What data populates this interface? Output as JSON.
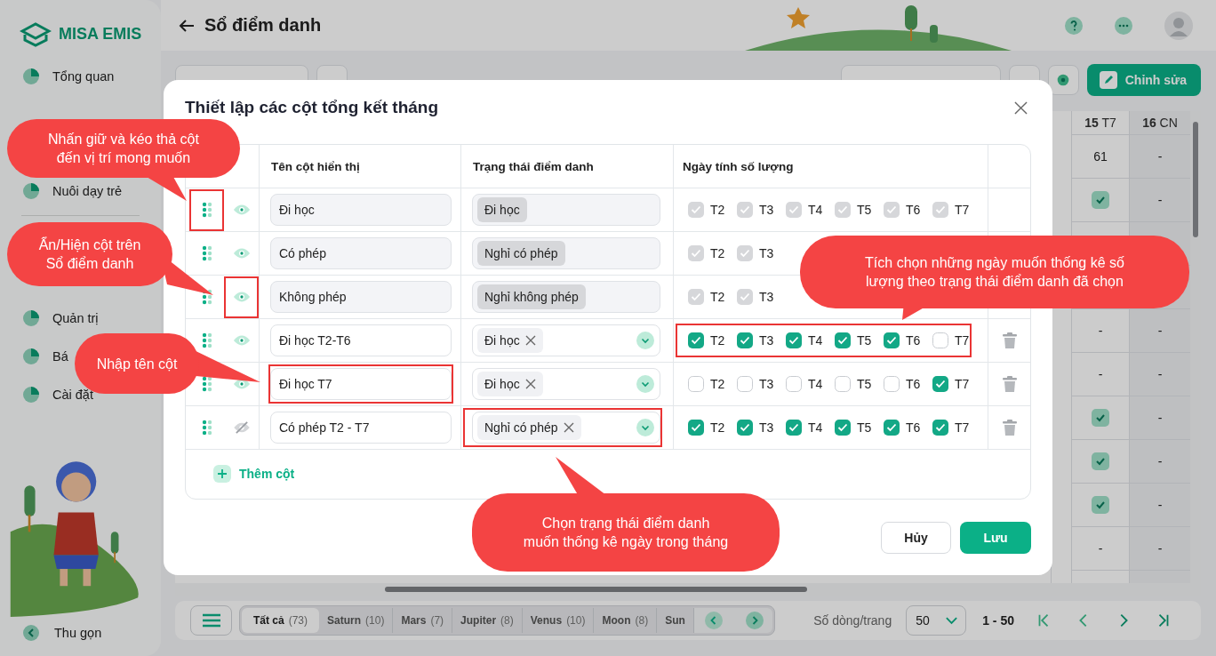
{
  "sidebar": {
    "logo": "MISA EMIS",
    "items": [
      {
        "kind": "item",
        "label": "Tổng quan"
      },
      {
        "kind": "covered"
      },
      {
        "kind": "covered"
      },
      {
        "kind": "item",
        "label": "Nuôi dạy trẻ"
      },
      {
        "kind": "divider"
      },
      {
        "kind": "covered"
      },
      {
        "kind": "covered"
      },
      {
        "kind": "item",
        "label": "Quản trị"
      },
      {
        "kind": "item",
        "label": "Bá"
      },
      {
        "kind": "item",
        "label": "Cài đặt"
      }
    ],
    "collapse": "Thu gọn"
  },
  "header": {
    "title": "Sổ điểm danh"
  },
  "toolbar": {
    "edit_button": "Chỉnh sửa"
  },
  "grid": {
    "columns": [
      "**15** T7",
      "**16** CN"
    ],
    "rows": [
      {
        "kind": "row",
        "cells": [
          {
            "kind": "text",
            "text": "61"
          },
          {
            "kind": "text",
            "text": "-"
          }
        ]
      },
      {
        "kind": "row",
        "cells": [
          {
            "kind": "check"
          },
          {
            "kind": "text",
            "text": "-"
          }
        ]
      },
      {
        "kind": "covered"
      },
      {
        "kind": "covered"
      },
      {
        "kind": "row",
        "cells": [
          {
            "kind": "text",
            "text": "-"
          },
          {
            "kind": "text",
            "text": "-"
          }
        ]
      },
      {
        "kind": "row",
        "cells": [
          {
            "kind": "text",
            "text": "-"
          },
          {
            "kind": "text",
            "text": "-"
          }
        ]
      },
      {
        "kind": "row",
        "cells": [
          {
            "kind": "check"
          },
          {
            "kind": "text",
            "text": "-"
          }
        ]
      },
      {
        "kind": "row",
        "cells": [
          {
            "kind": "check"
          },
          {
            "kind": "text",
            "text": "-"
          }
        ]
      },
      {
        "kind": "row",
        "cells": [
          {
            "kind": "check"
          },
          {
            "kind": "text",
            "text": "-"
          }
        ]
      },
      {
        "kind": "row",
        "cells": [
          {
            "kind": "text",
            "text": "-"
          },
          {
            "kind": "text",
            "text": "-"
          }
        ]
      }
    ]
  },
  "bottom": {
    "tabs": [
      {
        "label": "Tất cả",
        "count": "(73)",
        "selected": true
      },
      {
        "label": "Saturn",
        "count": "(10)",
        "selected": false
      },
      {
        "label": "Mars",
        "count": "(7)",
        "selected": false
      },
      {
        "label": "Jupiter",
        "count": "(8)",
        "selected": false
      },
      {
        "label": "Venus",
        "count": "(10)",
        "selected": false
      },
      {
        "label": "Moon",
        "count": "(8)",
        "selected": false
      },
      {
        "label": "Sun",
        "selected": false
      }
    ],
    "page_size_label": "Số dòng/trang",
    "page_size": "50",
    "range": "1 - 50"
  },
  "dialog": {
    "title": "Thiết lập các cột tổng kết tháng",
    "columns": [
      "Tên cột hiển thị",
      "Trạng thái điểm danh",
      "Ngày tính số lượng"
    ],
    "rows": [
      {
        "name": "Đi học",
        "visible": true,
        "locked": true,
        "marks": {
          "handle": true,
          "eye": false,
          "name": false,
          "status": false,
          "days": false
        },
        "statuses": [
          "Đi học"
        ],
        "days": [
          {
            "label": "T2",
            "checked": true
          },
          {
            "label": "T3",
            "checked": true
          },
          {
            "label": "T4",
            "checked": true
          },
          {
            "label": "T5",
            "checked": true
          },
          {
            "label": "T6",
            "checked": true
          },
          {
            "label": "T7",
            "checked": true
          }
        ]
      },
      {
        "name": "Có phép",
        "visible": true,
        "locked": true,
        "marks": {
          "handle": false,
          "eye": false,
          "name": false,
          "status": false,
          "days": false
        },
        "statuses": [
          "Nghỉ có phép"
        ],
        "days": [
          {
            "label": "T2",
            "checked": true
          },
          {
            "label": "T3",
            "checked": true
          }
        ]
      },
      {
        "name": "Không phép",
        "visible": true,
        "locked": true,
        "marks": {
          "handle": false,
          "eye": true,
          "name": false,
          "status": false,
          "days": false
        },
        "statuses": [
          "Nghỉ không phép"
        ],
        "days": [
          {
            "label": "T2",
            "checked": true
          },
          {
            "label": "T3",
            "checked": true
          }
        ]
      },
      {
        "name": "Đi học T2-T6",
        "visible": true,
        "locked": false,
        "marks": {
          "handle": false,
          "eye": false,
          "name": false,
          "status": false,
          "days": true
        },
        "statuses": [
          "Đi học"
        ],
        "days": [
          {
            "label": "T2",
            "checked": true
          },
          {
            "label": "T3",
            "checked": true
          },
          {
            "label": "T4",
            "checked": true
          },
          {
            "label": "T5",
            "checked": true
          },
          {
            "label": "T6",
            "checked": true
          },
          {
            "label": "T7",
            "checked": false
          }
        ]
      },
      {
        "name": "Đi học T7",
        "visible": true,
        "locked": false,
        "marks": {
          "handle": false,
          "eye": false,
          "name": true,
          "status": false,
          "days": false
        },
        "statuses": [
          "Đi học"
        ],
        "days": [
          {
            "label": "T2",
            "checked": false
          },
          {
            "label": "T3",
            "checked": false
          },
          {
            "label": "T4",
            "checked": false
          },
          {
            "label": "T5",
            "checked": false
          },
          {
            "label": "T6",
            "checked": false
          },
          {
            "label": "T7",
            "checked": true
          }
        ]
      },
      {
        "name": "Có phép T2 - T7",
        "visible": false,
        "locked": false,
        "marks": {
          "handle": false,
          "eye": false,
          "name": false,
          "status": true,
          "days": false
        },
        "statuses": [
          "Nghỉ có phép"
        ],
        "days": [
          {
            "label": "T2",
            "checked": true
          },
          {
            "label": "T3",
            "checked": true
          },
          {
            "label": "T4",
            "checked": true
          },
          {
            "label": "T5",
            "checked": true
          },
          {
            "label": "T6",
            "checked": true
          },
          {
            "label": "T7",
            "checked": true
          }
        ]
      }
    ],
    "add_label": "Thêm cột",
    "cancel": "Hủy",
    "save": "Lưu"
  },
  "callouts": [
    {
      "text": "Nhấn giữ và kéo thả cột\nđến vị trí mong muốn"
    },
    {
      "text": "Ẩn/Hiện cột trên\nSổ điểm danh"
    },
    {
      "text": "Nhập tên cột"
    },
    {
      "text": "Chọn trạng thái điểm danh\nmuốn thống kê ngày trong tháng"
    },
    {
      "text": "Tích chọn những ngày muốn thống kê số\nlượng theo trạng thái điểm danh đã chọn"
    }
  ]
}
